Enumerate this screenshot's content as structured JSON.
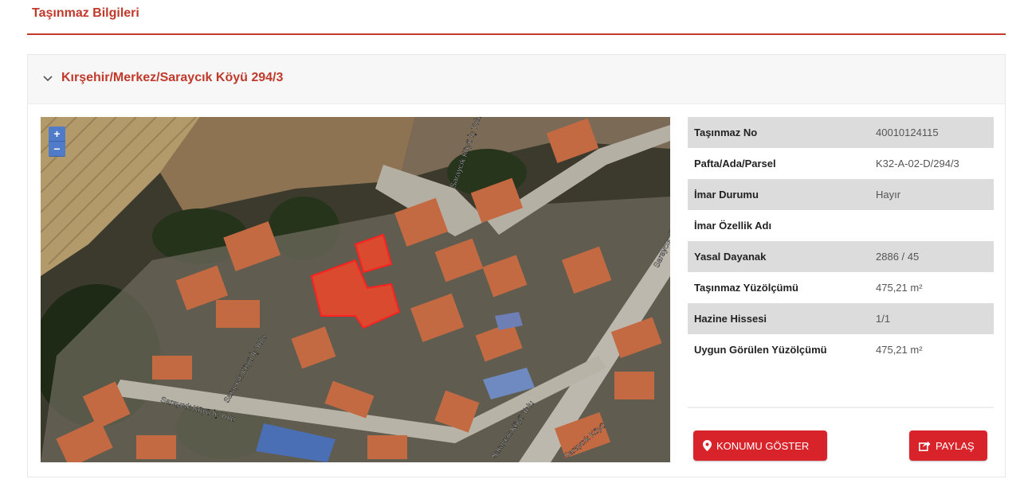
{
  "page": {
    "title": "Taşınmaz Bilgileri"
  },
  "card": {
    "title": "Kırşehir/Merkez/Saraycık Köyü 294/3"
  },
  "map": {
    "zoom_in": "+",
    "zoom_out": "−",
    "road_labels": [
      "Saraycık Köyü İç Yolu",
      "Saraycık Köyü İç Yolu",
      "Saraycık Köyü Yolu",
      "Saraycık Köyü",
      "Saraycık Köyü İç Yolu",
      "Saraycık Köyü"
    ]
  },
  "info": {
    "rows": [
      {
        "label": "Taşınmaz No",
        "value": "40010124115"
      },
      {
        "label": "Pafta/Ada/Parsel",
        "value": "K32-A-02-D/294/3"
      },
      {
        "label": "İmar Durumu",
        "value": "Hayır"
      },
      {
        "label": "İmar Özellik Adı",
        "value": ""
      },
      {
        "label": "Yasal Dayanak",
        "value": "2886 / 45"
      },
      {
        "label": "Taşınmaz Yüzölçümü",
        "value": "475,21 m²"
      },
      {
        "label": "Hazine Hissesi",
        "value": "1/1"
      },
      {
        "label": "Uygun Görülen Yüzölçümü",
        "value": "475,21 m²"
      }
    ]
  },
  "buttons": {
    "show_location": "KONUMU GÖSTER",
    "share": "PAYLAŞ"
  },
  "colors": {
    "accent": "#c0392b",
    "button": "#d9232b",
    "row_alt": "#dcdcdc"
  }
}
